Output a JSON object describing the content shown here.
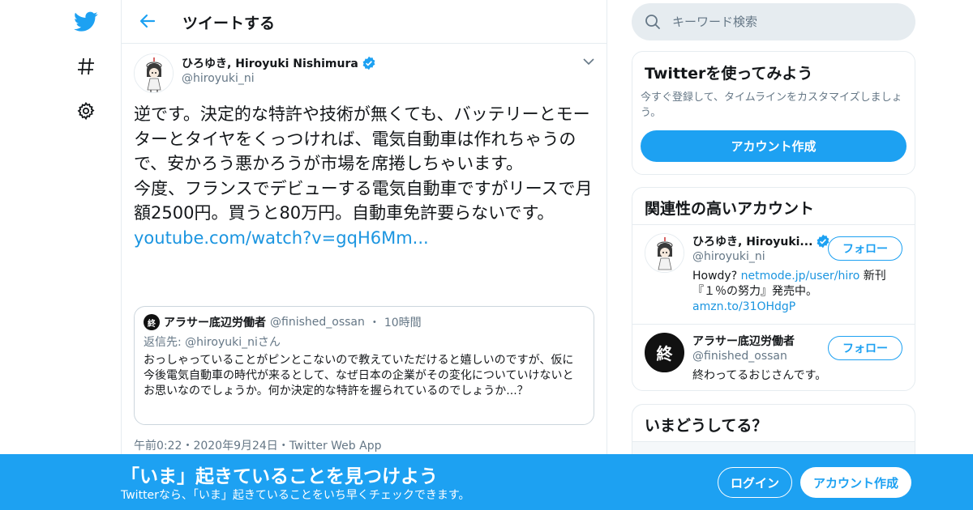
{
  "nav": {
    "icons": [
      "twitter-bird-icon",
      "hashtag-icon",
      "gear-icon"
    ]
  },
  "header": {
    "title": "ツイートする"
  },
  "tweet": {
    "author_name": "ひろゆき, Hiroyuki Nishimura",
    "author_handle": "@hiroyuki_ni",
    "text": "逆です。決定的な特許や技術が無くても、バッテリーとモーターとタイヤをくっつければ、電気自動車は作れちゃうので、安かろう悪かろうが市場を席捲しちゃいます。\n今度、フランスでデビューする電気自動車ですがリースで月額2500円。買うと80万円。自動車免許要らないです。",
    "link": "youtube.com/watch?v=gqH6Mm...",
    "meta": "午前0:22・2020年9月24日・Twitter Web App"
  },
  "quote": {
    "avatar_char": "終",
    "name": "アラサー底辺労働者",
    "handle": "@finished_ossan",
    "dot": "・",
    "time": "10時間",
    "reply_to": "返信先: @hiroyuki_niさん",
    "body": "おっしゃっていることがピンとこないので教えていただけると嬉しいのですが、仮に今後電気自動車の時代が来るとして、なぜ日本の企業がその変化についていけないとお思いなのでしょうか。何か決定的な特許を握られているのでしょうか...？"
  },
  "search": {
    "placeholder": "キーワード検索"
  },
  "signup_card": {
    "title": "Twitterを使ってみよう",
    "desc": "今すぐ登録して、タイムラインをカスタマイズしましょう。",
    "button": "アカウント作成"
  },
  "related": {
    "title": "関連性の高いアカウント",
    "accounts": [
      {
        "name": "ひろゆき, Hiroyuki...",
        "handle": "@hiroyuki_ni",
        "follow": "フォロー",
        "bio_pre": "Howdy? ",
        "bio_link": "netmode.jp/user/hiro",
        "bio_mid": " 新刊『１％の努力』発売中。",
        "bio_link2": "amzn.to/31OHdgP"
      },
      {
        "name": "アラサー底辺労働者",
        "handle": "@finished_ossan",
        "follow": "フォロー",
        "bio": "終わってるおじさんです。",
        "avatar_char": "終"
      }
    ]
  },
  "trends": {
    "title": "いまどうしてる？"
  },
  "banner": {
    "title": "「いま」起きていることを見つけよう",
    "subtitle": "Twitterなら、「いま」起きていることをいち早くチェックできます。",
    "login": "ログイン",
    "signup": "アカウント作成"
  },
  "colors": {
    "brand": "#1da1f2",
    "link": "#1b95e0",
    "secondary_text": "#657786",
    "border": "#e6ecf0"
  }
}
